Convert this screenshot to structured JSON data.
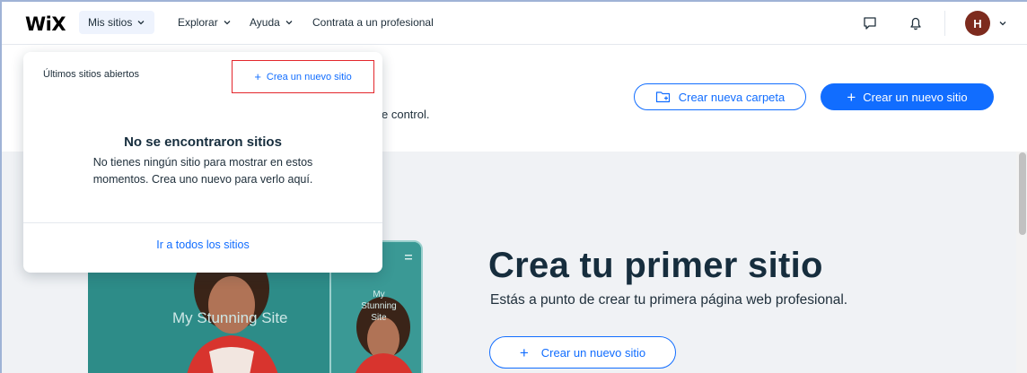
{
  "topbar": {
    "logo": "WiX",
    "nav": {
      "my_sites": "Mis sitios",
      "explore": "Explorar",
      "help": "Ayuda",
      "hire": "Contrata a un profesional"
    },
    "avatar_initial": "H"
  },
  "header": {
    "subtitle_fragment": "e control.",
    "new_folder_button": "Crear nueva carpeta",
    "new_site_button": "Crear un nuevo sitio"
  },
  "hero": {
    "title": "Crea tu primer sitio",
    "subtitle": "Estás a punto de crear tu primera página web profesional.",
    "button": "Crear un nuevo sitio",
    "preview_desktop_text": "My Stunning Site",
    "preview_mobile_text": "My Stunning Site"
  },
  "dropdown": {
    "recent_label": "Últimos sitios abiertos",
    "create_new": "Crea un nuevo sitio",
    "empty_title": "No se encontraron sitios",
    "empty_text": "No tienes ningún sitio para mostrar en estos momentos. Crea uno nuevo para verlo aquí.",
    "all_sites_link": "Ir a todos los sitios"
  },
  "colors": {
    "accent": "#116dff",
    "highlight_border": "#e3262c",
    "avatar_bg": "#7d2b1e",
    "main_bg": "#f0f2f5"
  }
}
